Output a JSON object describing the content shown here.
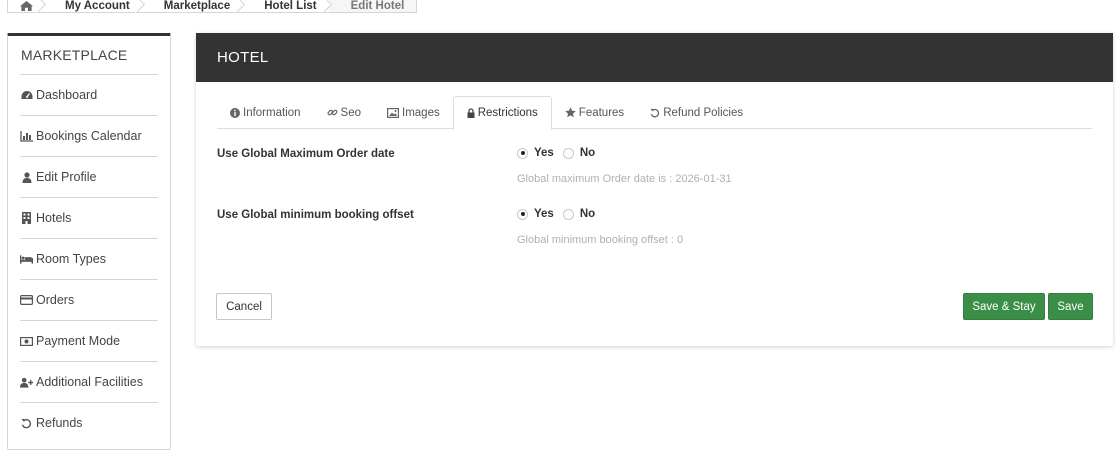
{
  "breadcrumb": {
    "home_icon": "home-icon",
    "items": [
      "My Account",
      "Marketplace",
      "Hotel List",
      "Edit Hotel"
    ]
  },
  "sidebar": {
    "title": "MARKETPLACE",
    "items": [
      {
        "label": "Dashboard",
        "icon": "dashboard-icon"
      },
      {
        "label": "Bookings Calendar",
        "icon": "bar-chart-icon"
      },
      {
        "label": "Edit Profile",
        "icon": "user-icon"
      },
      {
        "label": "Hotels",
        "icon": "building-icon"
      },
      {
        "label": "Room Types",
        "icon": "bed-icon"
      },
      {
        "label": "Orders",
        "icon": "credit-card-icon"
      },
      {
        "label": "Payment Mode",
        "icon": "money-icon"
      },
      {
        "label": "Additional Facilities",
        "icon": "user-plus-icon"
      },
      {
        "label": "Refunds",
        "icon": "undo-icon"
      }
    ]
  },
  "panel": {
    "title": "HOTEL",
    "tabs": [
      {
        "label": "Information",
        "icon": "info-icon"
      },
      {
        "label": "Seo",
        "icon": "link-icon"
      },
      {
        "label": "Images",
        "icon": "image-icon"
      },
      {
        "label": "Restrictions",
        "icon": "lock-icon",
        "active": true
      },
      {
        "label": "Features",
        "icon": "star-icon"
      },
      {
        "label": "Refund Policies",
        "icon": "undo-icon"
      }
    ],
    "fields": [
      {
        "label": "Use Global Maximum Order date",
        "yes": "Yes",
        "no": "No",
        "selected": "Yes",
        "hint": "Global maximum Order date is : 2026-01-31"
      },
      {
        "label": "Use Global minimum booking offset",
        "yes": "Yes",
        "no": "No",
        "selected": "Yes",
        "hint": "Global minimum booking offset : 0"
      }
    ],
    "buttons": {
      "cancel": "Cancel",
      "save_stay": "Save & Stay",
      "save": "Save"
    }
  },
  "colors": {
    "header_bg": "#333333",
    "button_green": "#3b8e47"
  }
}
